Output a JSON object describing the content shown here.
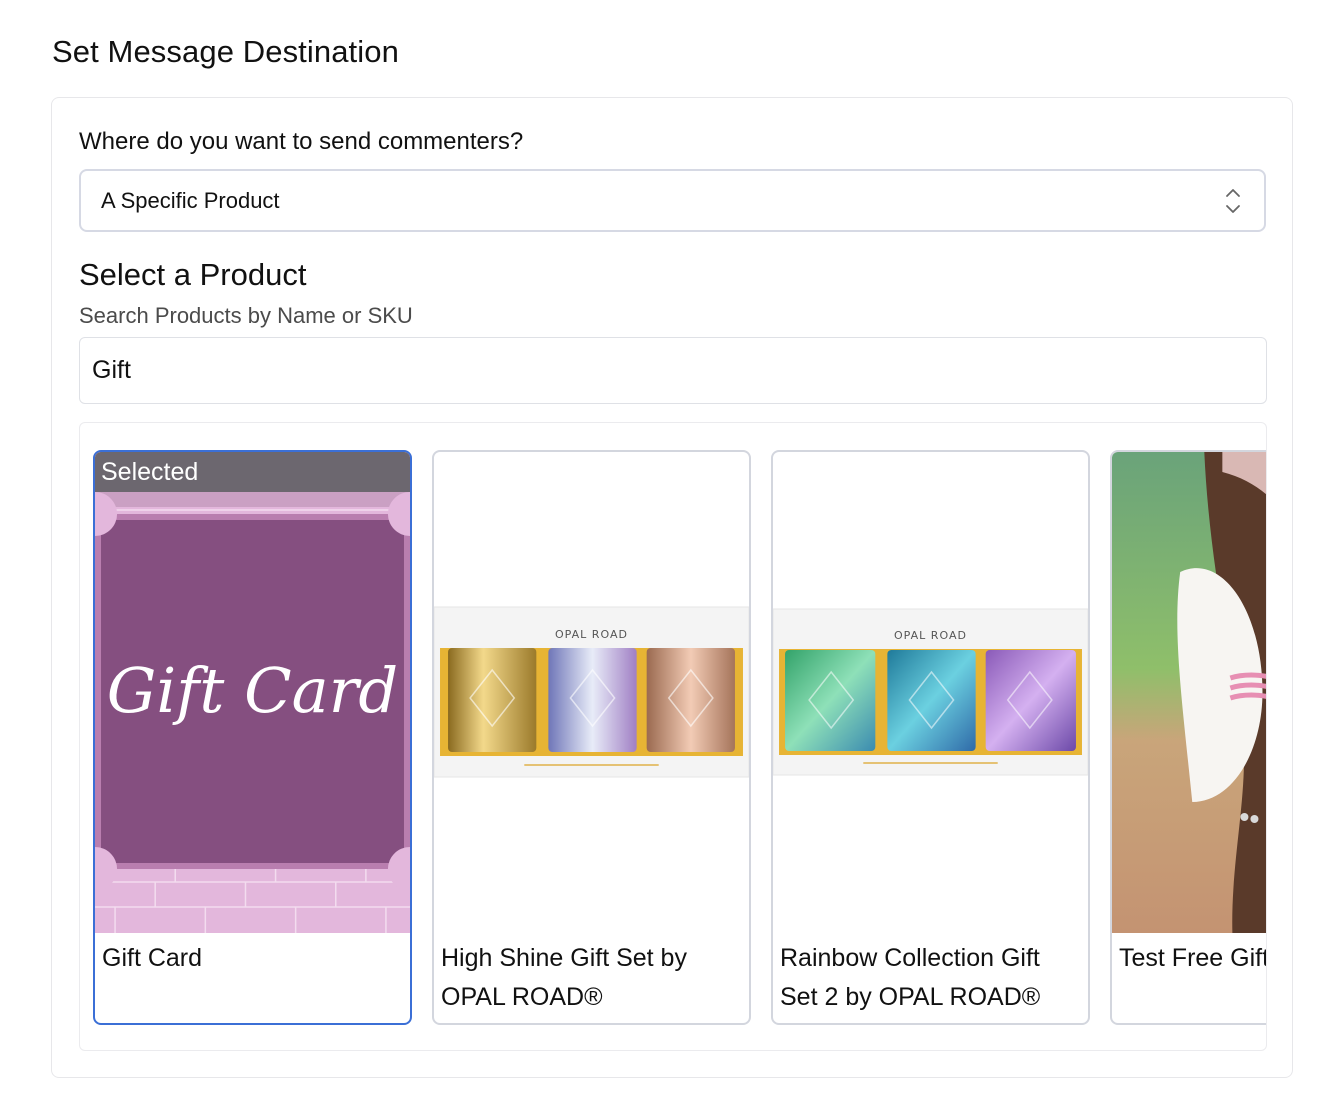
{
  "page": {
    "title": "Set Message Destination"
  },
  "destination": {
    "question": "Where do you want to send commenters?",
    "selected_value": "A Specific Product"
  },
  "product_picker": {
    "title": "Select a Product",
    "search_label": "Search Products by Name or SKU",
    "search_value": "Gift",
    "selected_badge": "Selected",
    "products": [
      {
        "title": "Gift Card",
        "image_text": "Gift Card",
        "selected": true
      },
      {
        "title": "High Shine Gift Set by OPAL ROAD®",
        "image_text": "OPAL ROAD",
        "selected": false
      },
      {
        "title": "Rainbow Collection Gift Set 2 by OPAL ROAD®",
        "image_text": "OPAL ROAD",
        "selected": false
      },
      {
        "title": "Test Free Gift",
        "selected": false
      }
    ]
  },
  "colors": {
    "selected_border": "#3b6fd6",
    "gift_card_purple": "#854f80"
  }
}
